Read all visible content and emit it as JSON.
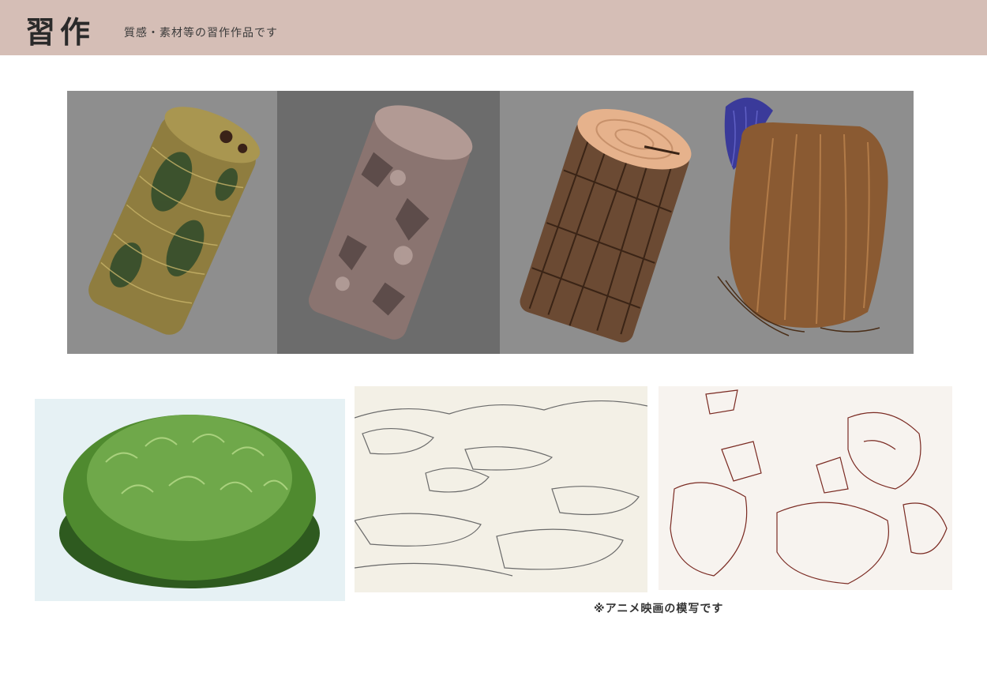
{
  "header": {
    "title": "習作",
    "subtitle": "質感・素材等の習作作品です"
  },
  "note": "※アニメ映画の模写です",
  "colors": {
    "header_bg": "#d5beb6",
    "panel_gray": "#8e8e8e",
    "panel_dark": "#6c6c6c",
    "snake_scale": "#a99650",
    "snake_spot": "#2e4a2a",
    "stone": "#8a7470",
    "wood_bark": "#6b4a33",
    "wood_top": "#e6b28c",
    "hair": "#8a5a32",
    "blue_hair": "#3a3a9a",
    "moss": "#4f8a2f",
    "sketch_paper": "#f3f0e6",
    "sketch_line": "#6a6a6a",
    "red_line": "#7a2a22"
  }
}
